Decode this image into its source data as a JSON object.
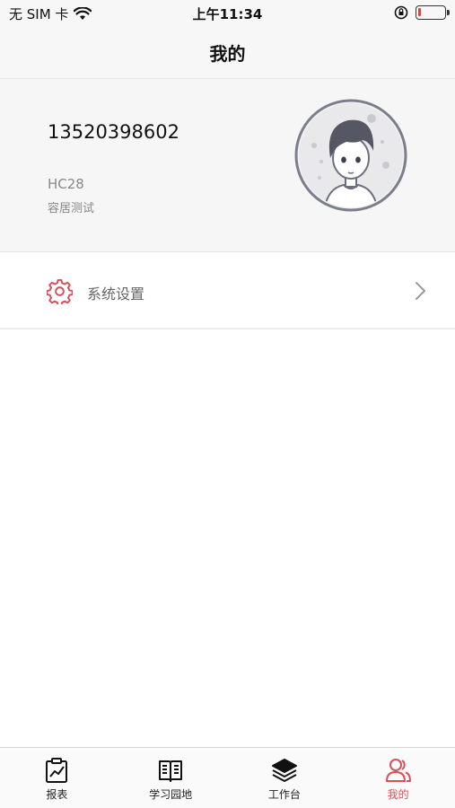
{
  "status": {
    "carrier": "无 SIM 卡",
    "time": "上午11:34"
  },
  "nav": {
    "title": "我的"
  },
  "profile": {
    "phone": "13520398602",
    "code": "HC28",
    "department": "容居测试"
  },
  "menu": {
    "settings_label": "系统设置"
  },
  "tabs": [
    {
      "label": "报表",
      "icon": "report-icon"
    },
    {
      "label": "学习园地",
      "icon": "book-icon"
    },
    {
      "label": "工作台",
      "icon": "layers-icon"
    },
    {
      "label": "我的",
      "icon": "user-icon",
      "active": true
    }
  ],
  "colors": {
    "accent": "#d7505a",
    "background": "#f6f6f6"
  }
}
